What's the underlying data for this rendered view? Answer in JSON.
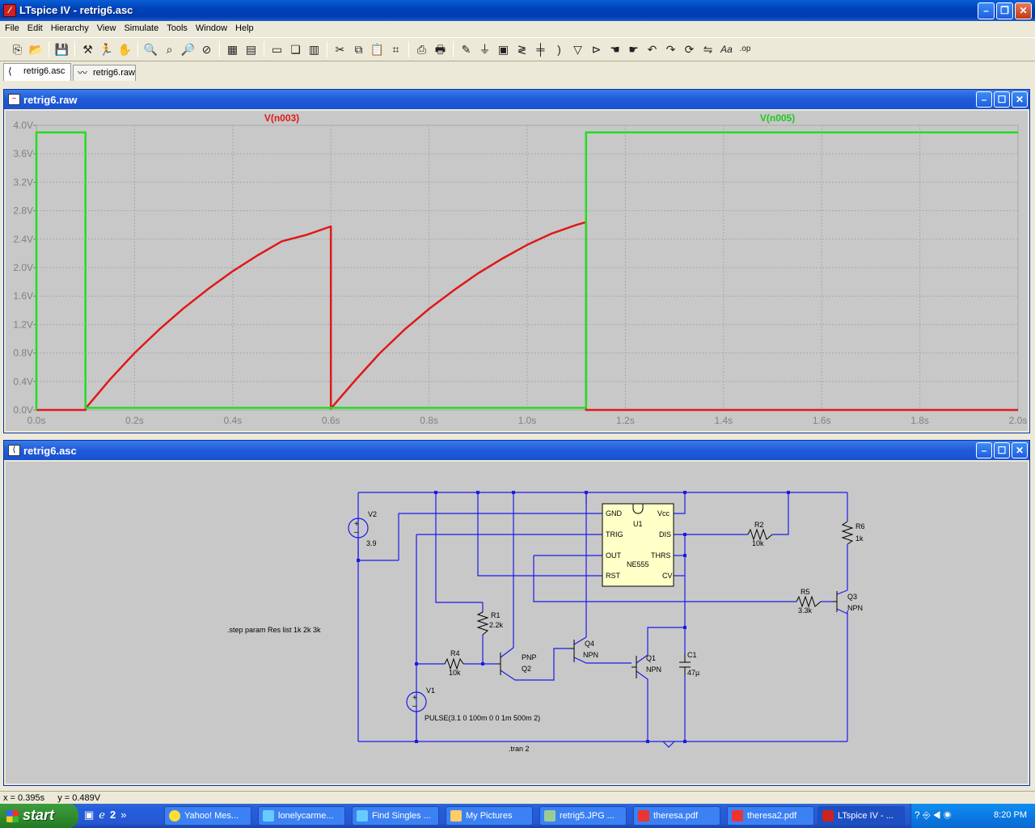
{
  "window": {
    "title": "LTspice IV - retrig6.asc"
  },
  "menu": [
    "File",
    "Edit",
    "Hierarchy",
    "View",
    "Simulate",
    "Tools",
    "Window",
    "Help"
  ],
  "toolbar": {
    "groups": [
      [
        "new-schematic",
        "open",
        "save"
      ],
      [
        "control-panel",
        "run",
        "halt"
      ],
      [
        "zoom-in",
        "pan",
        "zoom-out",
        "zoom-cancel"
      ],
      [
        "autorange",
        "grid"
      ],
      [
        "tile-horizontal",
        "cascade",
        "tile-vertical"
      ],
      [
        "cut",
        "copy",
        "paste",
        "find"
      ],
      [
        "print-setup",
        "print"
      ],
      [
        "draw-wire",
        "ground",
        "label-net",
        "resistor",
        "capacitor",
        "inductor",
        "diode",
        "component",
        "move",
        "drag",
        "undo",
        "redo",
        "rotate",
        "mirror",
        "text",
        "spice-directive"
      ]
    ],
    "labels": {
      "text": "Aa",
      "spice-directive": ".op"
    }
  },
  "tabs": [
    {
      "label": "retrig6.asc",
      "active": true
    },
    {
      "label": "retrig6.raw",
      "active": false
    }
  ],
  "waveform_window": {
    "title": "retrig6.raw"
  },
  "schematic_window": {
    "title": "retrig6.asc"
  },
  "chart_data": {
    "type": "line",
    "x_unit": "s",
    "xlim": [
      0,
      2.0
    ],
    "ylim": [
      0,
      4.0
    ],
    "x_ticks": [
      "0.0s",
      "0.2s",
      "0.4s",
      "0.6s",
      "0.8s",
      "1.0s",
      "1.2s",
      "1.4s",
      "1.6s",
      "1.8s",
      "2.0s"
    ],
    "y_ticks": [
      "0.0V",
      "0.4V",
      "0.8V",
      "1.2V",
      "1.6V",
      "2.0V",
      "2.4V",
      "2.8V",
      "3.2V",
      "3.6V",
      "4.0V"
    ],
    "x_tick_values": [
      0,
      0.2,
      0.4,
      0.6,
      0.8,
      1.0,
      1.2,
      1.4,
      1.6,
      1.8,
      2.0
    ],
    "y_tick_values": [
      0,
      0.4,
      0.8,
      1.2,
      1.6,
      2.0,
      2.4,
      2.8,
      3.2,
      3.6,
      4.0
    ],
    "grid": true,
    "series": [
      {
        "name": "V(n003)",
        "color": "#e01818",
        "x": [
          0.0,
          0.1,
          0.1,
          0.15,
          0.2,
          0.25,
          0.3,
          0.35,
          0.4,
          0.45,
          0.5,
          0.55,
          0.6,
          0.6,
          0.6,
          0.65,
          0.7,
          0.75,
          0.8,
          0.85,
          0.9,
          0.95,
          1.0,
          1.05,
          1.1,
          1.12,
          1.12,
          1.2,
          1.4,
          1.6,
          1.8,
          2.0
        ],
        "y": [
          0.0,
          0.0,
          0.02,
          0.43,
          0.8,
          1.13,
          1.43,
          1.7,
          1.95,
          2.17,
          2.37,
          2.46,
          2.58,
          2.58,
          0.02,
          0.42,
          0.8,
          1.13,
          1.42,
          1.68,
          1.92,
          2.13,
          2.32,
          2.48,
          2.6,
          2.64,
          0.0,
          0.0,
          0.0,
          0.0,
          0.0,
          0.0
        ]
      },
      {
        "name": "V(n005)",
        "color": "#22dd22",
        "x": [
          0.0,
          0.0,
          0.1,
          0.1,
          0.6,
          1.12,
          1.12,
          2.0
        ],
        "y": [
          0.0,
          3.9,
          3.9,
          0.03,
          0.03,
          0.03,
          3.9,
          3.9
        ]
      }
    ]
  },
  "schematic": {
    "directive_step": ".step param Res list 1k 2k 3k",
    "directive_tran": ".tran 2",
    "V1": {
      "name": "V1",
      "value": "PULSE(3.1 0 100m 0 0 1m 500m 2)"
    },
    "V2": {
      "name": "V2",
      "value": "3.9"
    },
    "U1": {
      "name": "U1",
      "model": "NE555",
      "pins": [
        "GND",
        "TRIG",
        "OUT",
        "RST",
        "Vcc",
        "DIS",
        "THRS",
        "CV"
      ]
    },
    "R1": {
      "name": "R1",
      "value": "2.2k"
    },
    "R2": {
      "name": "R2",
      "value": "10k"
    },
    "R4": {
      "name": "R4",
      "value": "10k"
    },
    "R5": {
      "name": "R5",
      "value": "3.3k"
    },
    "R6": {
      "name": "R6",
      "value": "1k"
    },
    "C1": {
      "name": "C1",
      "value": "47µ"
    },
    "Q1": {
      "name": "Q1",
      "type": "NPN"
    },
    "Q2": {
      "name": "Q2",
      "type": "PNP"
    },
    "Q3": {
      "name": "Q3",
      "type": "NPN"
    },
    "Q4": {
      "name": "Q4",
      "type": "NPN"
    }
  },
  "status": {
    "x": "x = 0.395s",
    "y": "y = 0.489V"
  },
  "taskbar": {
    "start": "start",
    "quick_launch_count": "2",
    "tasks": [
      {
        "label": "Yahoo! Mes...",
        "active": false
      },
      {
        "label": "lonelycarme...",
        "active": false
      },
      {
        "label": "Find Singles ...",
        "active": false
      },
      {
        "label": "My Pictures",
        "active": false
      },
      {
        "label": "retrig5.JPG ...",
        "active": false
      },
      {
        "label": "theresa.pdf",
        "active": false
      },
      {
        "label": "theresa2.pdf",
        "active": false
      },
      {
        "label": "LTspice IV - ...",
        "active": true
      }
    ],
    "clock": "8:20 PM"
  },
  "colors": {
    "wire": "#1a1aee",
    "plot_bg": "#c8c8c8",
    "grid": "#a8a8a8",
    "axis_text": "#808080",
    "titlebar": "#0a52d0"
  }
}
